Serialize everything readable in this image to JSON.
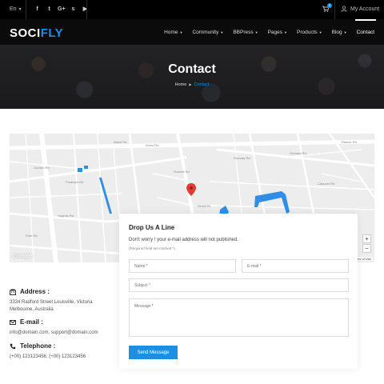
{
  "topbar": {
    "language": "En",
    "socials": [
      {
        "icon": "facebook-icon",
        "glyph": "f"
      },
      {
        "icon": "twitter-icon",
        "glyph": "t"
      },
      {
        "icon": "google-plus-icon",
        "glyph": "G+"
      },
      {
        "icon": "skype-icon",
        "glyph": "s"
      },
      {
        "icon": "youtube-icon",
        "glyph": "▶"
      }
    ],
    "cart_count": "0",
    "account_label": "My Account"
  },
  "nav": {
    "logo_main": "SOCI",
    "logo_accent": "FLY",
    "items": [
      {
        "label": "Home",
        "has_dropdown": true
      },
      {
        "label": "Community",
        "has_dropdown": true
      },
      {
        "label": "BBPress",
        "has_dropdown": true
      },
      {
        "label": "Pages",
        "has_dropdown": true
      },
      {
        "label": "Products",
        "has_dropdown": true
      },
      {
        "label": "Blog",
        "has_dropdown": true
      },
      {
        "label": "Contact",
        "has_dropdown": false,
        "active": true
      }
    ]
  },
  "hero": {
    "title": "Contact",
    "breadcrumb_home": "Home",
    "breadcrumb_current": "Contact"
  },
  "map": {
    "labels": [
      "Wave Rd",
      "Ames Rd",
      "Fordham Rd",
      "Runway Rd",
      "Orchard Rd",
      "Rainier Rd",
      "Gordon Rd",
      "Summit Rd",
      "Hughes Rd",
      "Grove St",
      "Market Rd",
      "Chaucer Rd",
      "Park Rd",
      "Rochester Rd",
      "Denmark Rd",
      "Kilmore Rd"
    ],
    "google_label": "Google",
    "zoom_in": "+",
    "zoom_out": "−",
    "terms": "Terms of Use"
  },
  "contact": {
    "address_title": "Address :",
    "address_text": "3334 Radford Street Louisville, Victoria Melbourne, Australia",
    "email_title": "E-mail :",
    "email_text": "info@domain.com, support@domain.com",
    "phone_title": "Telephone :",
    "phone_text": "(+00) 123123456, (+00) 123123456"
  },
  "form": {
    "title": "Drop Us A Line",
    "note": "Don't worry ! your e-mail address will not published.",
    "required": "(Required field are marked *)",
    "name_placeholder": "Name *",
    "email_placeholder": "E-mail *",
    "subject_placeholder": "Subject *",
    "message_placeholder": "Message *",
    "submit_label": "Send Message"
  },
  "colors": {
    "accent": "#1a8fe3",
    "header_bg": "#000000",
    "water": "#2f8fe6"
  }
}
